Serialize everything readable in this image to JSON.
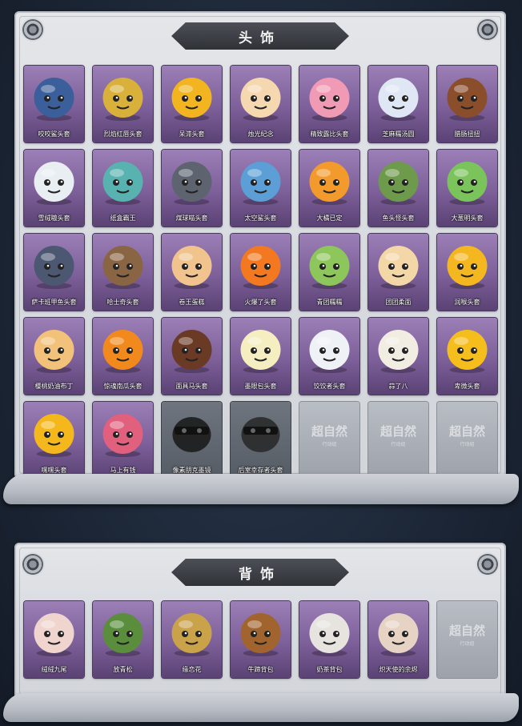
{
  "sections": [
    {
      "title": "头饰",
      "items": [
        {
          "name": "咬咬鲨头套",
          "icon": "shark-icon",
          "bg": "#3b5f9a"
        },
        {
          "name": "烈焰红唇头套",
          "icon": "pikachu-sunglasses-icon",
          "bg": "#d9b13a"
        },
        {
          "name": "呆滞头套",
          "icon": "dazed-face-icon",
          "bg": "#f2b51f"
        },
        {
          "name": "烛光纪念",
          "icon": "candle-icon",
          "bg": "#f5d8b0"
        },
        {
          "name": "精致露比头套",
          "icon": "pink-pig-icon",
          "bg": "#f19ab6"
        },
        {
          "name": "芝麻糯汤圆",
          "icon": "rice-ball-flower-icon",
          "bg": "#dfe7f5"
        },
        {
          "name": "腊肠扭扭",
          "icon": "dachshund-icon",
          "bg": "#8a4e2b"
        },
        {
          "name": "雪绒嗷头套",
          "icon": "snowman-reindeer-icon",
          "bg": "#e9eef3"
        },
        {
          "name": "纸盒霸王",
          "icon": "box-dinosaur-icon",
          "bg": "#58b2b0"
        },
        {
          "name": "煤球喵头套",
          "icon": "gray-cat-icon",
          "bg": "#5d6470"
        },
        {
          "name": "太空鲨头套",
          "icon": "space-shark-icon",
          "bg": "#5b9fd6"
        },
        {
          "name": "大橘已定",
          "icon": "orange-slice-icon",
          "bg": "#f39a2c"
        },
        {
          "name": "鱼头怪头套",
          "icon": "fish-monster-icon",
          "bg": "#6e9a4c"
        },
        {
          "name": "大葱明头套",
          "icon": "green-onion-icon",
          "bg": "#7bc45b"
        },
        {
          "name": "萨卡班甲鱼头套",
          "icon": "armored-fish-icon",
          "bg": "#4c5872"
        },
        {
          "name": "哈士奇头套",
          "icon": "husky-sunglasses-icon",
          "bg": "#8a6543"
        },
        {
          "name": "卷王蛋糕",
          "icon": "roll-cake-icon",
          "bg": "#f0c48c"
        },
        {
          "name": "火爆了头套",
          "icon": "fire-face-icon",
          "bg": "#f4781f"
        },
        {
          "name": "青团糯糯",
          "icon": "green-rice-ball-icon",
          "bg": "#8dc65a"
        },
        {
          "name": "团团柔面",
          "icon": "hamster-bun-icon",
          "bg": "#f4d7a6"
        },
        {
          "name": "润喉头套",
          "icon": "smug-face-icon",
          "bg": "#f5b720"
        },
        {
          "name": "樱桃奶油布丁",
          "icon": "pudding-icon",
          "bg": "#f3c27a"
        },
        {
          "name": "惊魂南瓜头套",
          "icon": "pumpkin-icon",
          "bg": "#f2891c"
        },
        {
          "name": "面具马头套",
          "icon": "horse-head-icon",
          "bg": "#6b3a25"
        },
        {
          "name": "墨眼包头套",
          "icon": "lightbulb-crown-icon",
          "bg": "#f4eec0"
        },
        {
          "name": "饺饺者头套",
          "icon": "dumpling-cloud-icon",
          "bg": "#eef1f6"
        },
        {
          "name": "蒜了八",
          "icon": "garlic-icon",
          "bg": "#f2ede2"
        },
        {
          "name": "卑微头套",
          "icon": "timid-face-icon",
          "bg": "#f5be1c"
        },
        {
          "name": "嘿嘿头套",
          "icon": "grin-face-icon",
          "bg": "#f5b81c"
        },
        {
          "name": "马上有钱",
          "icon": "pink-horse-icon",
          "bg": "#e0607e"
        },
        {
          "name": "像素朋克墨镜",
          "icon": "pixel-sunglasses-icon",
          "bg": "#1c1c1c",
          "gray": true
        },
        {
          "name": "后室幸存者头套",
          "icon": "gas-mask-helmet-icon",
          "bg": "#2a2a2a",
          "gray": true
        },
        {
          "name": "",
          "icon": "placeholder-icon",
          "empty": true
        },
        {
          "name": "",
          "icon": "placeholder-icon",
          "empty": true
        },
        {
          "name": "",
          "icon": "placeholder-icon",
          "empty": true
        }
      ]
    },
    {
      "title": "背饰",
      "items": [
        {
          "name": "绒绒九尾",
          "icon": "nine-tail-fox-icon",
          "bg": "#f0d5cf"
        },
        {
          "name": "放青松",
          "icon": "potted-pine-icon",
          "bg": "#5a8e3c"
        },
        {
          "name": "缘恋花",
          "icon": "bell-wreath-icon",
          "bg": "#c9a24a"
        },
        {
          "name": "牛蹄背包",
          "icon": "cow-backpack-icon",
          "bg": "#a2642e"
        },
        {
          "name": "奶茶背包",
          "icon": "milk-tea-backpack-icon",
          "bg": "#e7e3df"
        },
        {
          "name": "炽天使的余烬",
          "icon": "angel-girl-icon",
          "bg": "#e6d3c4"
        },
        {
          "name": "",
          "icon": "placeholder-icon",
          "empty": true
        }
      ]
    }
  ],
  "watermark": {
    "title": "超自然",
    "sub": "行动组"
  }
}
